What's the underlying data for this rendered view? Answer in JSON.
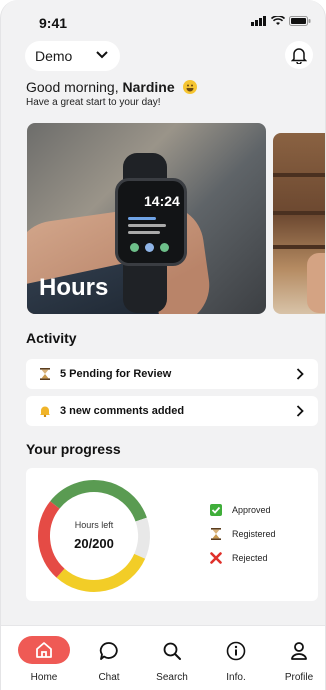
{
  "status": {
    "time": "9:41"
  },
  "header": {
    "org_select": "Demo"
  },
  "greeting": {
    "prefix": "Good morning, ",
    "name": "Nardine",
    "subtitle": "Have a great start to your day!"
  },
  "cards": [
    {
      "title": "Hours",
      "watch_time": "14:24"
    }
  ],
  "activity": {
    "title": "Activity",
    "items": [
      {
        "label": "5 Pending for Review",
        "icon": "hourglass-icon"
      },
      {
        "label": "3 new comments added",
        "icon": "bell-icon"
      }
    ]
  },
  "progress": {
    "title": "Your progress",
    "donut_label": "Hours left",
    "donut_value": "20/200",
    "legend": [
      {
        "label": "Approved",
        "icon": "check-box-icon",
        "color": "#3fae3a"
      },
      {
        "label": "Registered",
        "icon": "hourglass-icon",
        "color": "#8a6a3a"
      },
      {
        "label": "Rejected",
        "icon": "x-icon",
        "color": "#e0302a"
      }
    ],
    "segments": [
      {
        "name": "Approved",
        "fraction": 0.34,
        "color": "#5a9b52"
      },
      {
        "name": "Remaining",
        "fraction": 0.12,
        "color": "#e8e8e8"
      },
      {
        "name": "Registered",
        "fraction": 0.3,
        "color": "#f2cd27"
      },
      {
        "name": "Rejected",
        "fraction": 0.24,
        "color": "#e54b45"
      }
    ]
  },
  "tabs": [
    {
      "label": "Home",
      "icon": "home-icon",
      "active": true
    },
    {
      "label": "Chat",
      "icon": "chat-icon"
    },
    {
      "label": "Search",
      "icon": "search-icon"
    },
    {
      "label": "Info.",
      "icon": "info-icon"
    },
    {
      "label": "Profile",
      "icon": "profile-icon"
    }
  ],
  "colors": {
    "accent": "#ef5a55",
    "background": "#f2f2f3"
  }
}
